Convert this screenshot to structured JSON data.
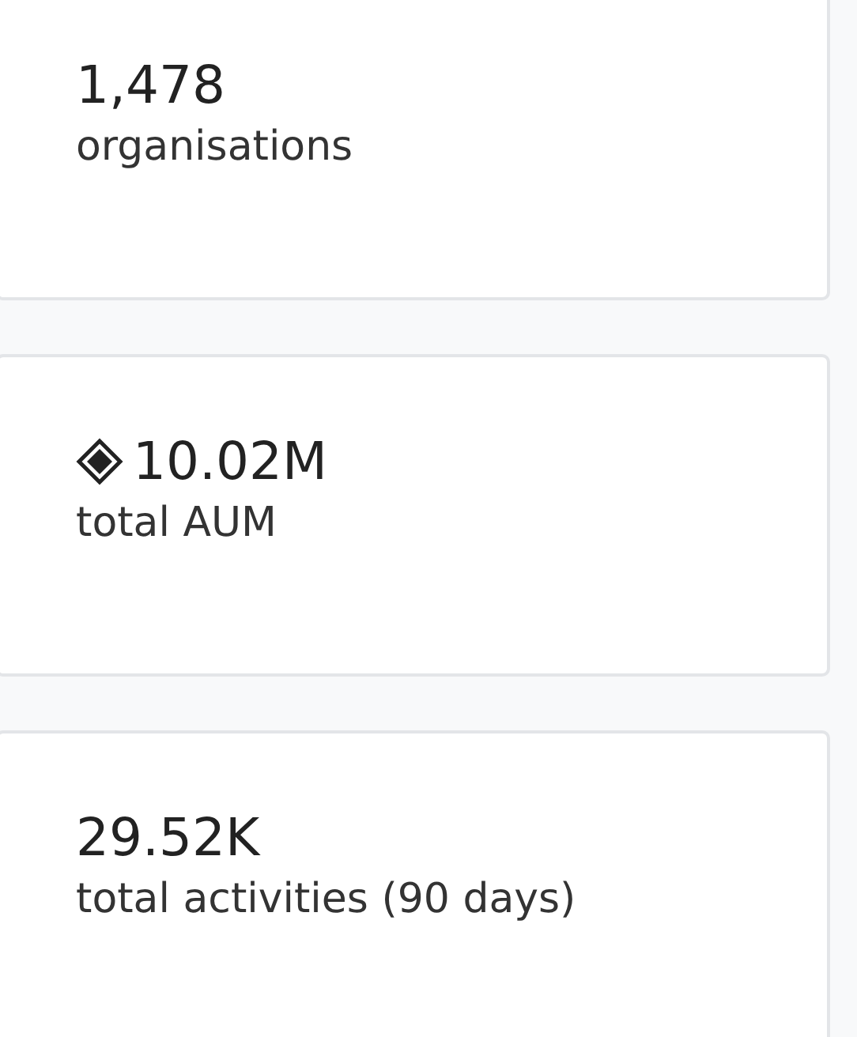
{
  "stats": [
    {
      "value": "1,478",
      "label": "organisations",
      "has_icon": false
    },
    {
      "value": "10.02M",
      "label": "total AUM",
      "has_icon": true
    },
    {
      "value": "29.52K",
      "label": "total activities (90 days)",
      "has_icon": false
    }
  ]
}
